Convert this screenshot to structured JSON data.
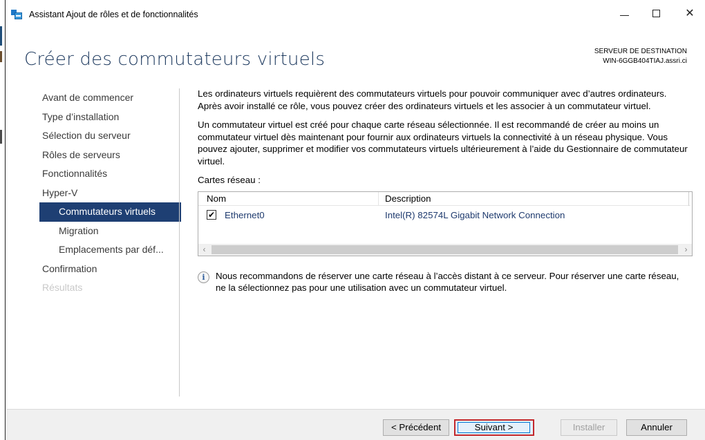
{
  "window": {
    "title": "Assistant Ajout de rôles et de fonctionnalités",
    "minimize": "—",
    "maximize": "☐",
    "close": "✕"
  },
  "page": {
    "title": "Créer des commutateurs virtuels",
    "dest_label": "SERVEUR DE DESTINATION",
    "dest_server": "WIN-6GGB404TIAJ.assri.ci"
  },
  "nav": {
    "items": [
      {
        "label": "Avant de commencer",
        "state": "normal"
      },
      {
        "label": "Type d’installation",
        "state": "normal"
      },
      {
        "label": "Sélection du serveur",
        "state": "normal"
      },
      {
        "label": "Rôles de serveurs",
        "state": "normal"
      },
      {
        "label": "Fonctionnalités",
        "state": "normal"
      },
      {
        "label": "Hyper-V",
        "state": "normal"
      },
      {
        "label": "Commutateurs virtuels",
        "state": "active"
      },
      {
        "label": "Migration",
        "state": "normal"
      },
      {
        "label": "Emplacements par déf...",
        "state": "normal"
      },
      {
        "label": "Confirmation",
        "state": "normal"
      },
      {
        "label": "Résultats",
        "state": "disabled"
      }
    ]
  },
  "content": {
    "para1": "Les ordinateurs virtuels requièrent des commutateurs virtuels pour pouvoir communiquer avec d’autres ordinateurs. Après avoir installé ce rôle, vous pouvez créer des ordinateurs virtuels et les associer à un commutateur virtuel.",
    "para2": "Un commutateur virtuel est créé pour chaque carte réseau sélectionnée. Il est recommandé de créer au moins un commutateur virtuel dès maintenant pour fournir aux ordinateurs virtuels la connectivité à un réseau physique. Vous pouvez ajouter, supprimer et modifier vos commutateurs virtuels ultérieurement à l’aide du Gestionnaire de commutateur virtuel.",
    "cards_label": "Cartes réseau :",
    "columns": {
      "name": "Nom",
      "description": "Description"
    },
    "adapters": [
      {
        "name": "Ethernet0",
        "description": "Intel(R) 82574L Gigabit Network Connection",
        "checked": "✔"
      }
    ],
    "scroll_left": "‹",
    "scroll_right": "›",
    "info_icon": "i",
    "info_text": "Nous recommandons de réserver une carte réseau à l’accès distant à ce serveur. Pour réserver une carte réseau, ne la sélectionnez pas pour une utilisation avec un commutateur virtuel."
  },
  "footer": {
    "prev": "< Précédent",
    "next": "Suivant >",
    "install": "Installer",
    "cancel": "Annuler"
  },
  "colors": {
    "title": "#1e3a5f",
    "nav_active_bg": "#1e3f73",
    "link_text": "#1e3a6e",
    "highlight_border": "#c3272b"
  }
}
